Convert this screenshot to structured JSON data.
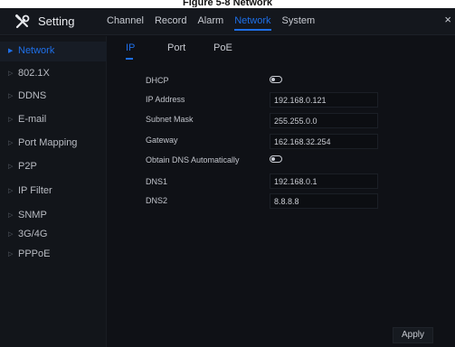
{
  "caption": "Figure 5-8 Network",
  "app": {
    "title": "Setting",
    "logo_icon": "tools-icon"
  },
  "menu": {
    "items": [
      "Channel",
      "Record",
      "Alarm",
      "Network",
      "System"
    ],
    "active": "Network",
    "close_label": "×"
  },
  "sidebar": {
    "items": [
      {
        "label": "Network"
      },
      {
        "label": "802.1X"
      },
      {
        "label": "DDNS"
      },
      {
        "label": "E-mail"
      },
      {
        "label": "Port Mapping"
      },
      {
        "label": "P2P"
      },
      {
        "label": "IP Filter"
      },
      {
        "label": "SNMP"
      },
      {
        "label": "3G/4G"
      },
      {
        "label": "PPPoE"
      }
    ],
    "active": "Network"
  },
  "tabs": {
    "items": [
      "IP",
      "Port",
      "PoE"
    ],
    "active": "IP"
  },
  "form": {
    "dhcp_label": "DHCP",
    "dhcp_enabled": false,
    "ip_label": "IP Address",
    "ip_value": "192.168.0.121",
    "subnet_label": "Subnet Mask",
    "subnet_value": "255.255.0.0",
    "gateway_label": "Gateway",
    "gateway_value": "162.168.32.254",
    "auto_dns_label": "Obtain DNS Automatically",
    "auto_dns_enabled": false,
    "dns1_label": "DNS1",
    "dns1_value": "192.168.0.1",
    "dns2_label": "DNS2",
    "dns2_value": "8.8.8.8"
  },
  "apply_label": "Apply",
  "colors": {
    "accent": "#1e6fe8",
    "background": "#0f1116",
    "sidebar": "#12151a"
  }
}
